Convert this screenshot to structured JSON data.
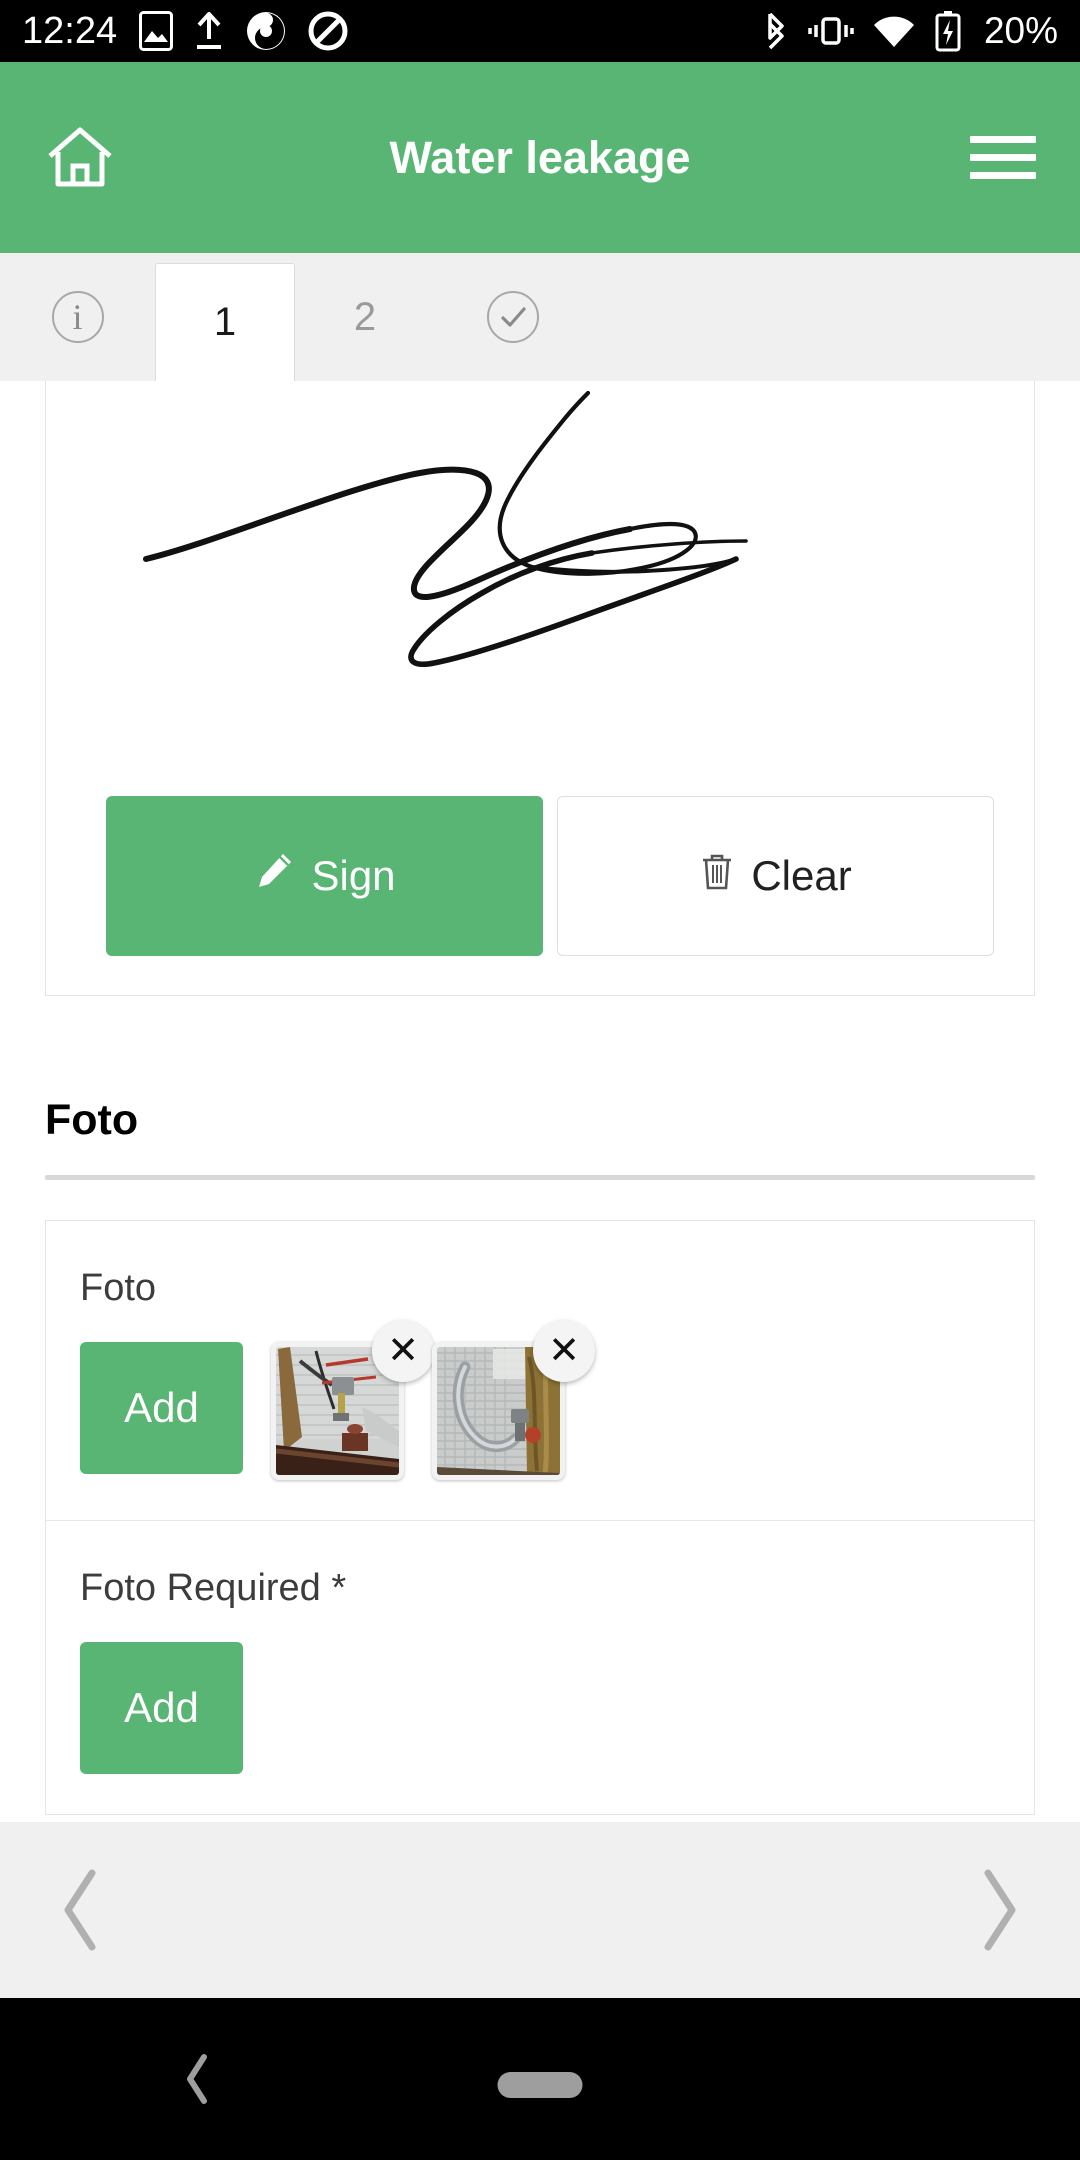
{
  "statusbar": {
    "time": "12:24",
    "left_icons": [
      "image-icon",
      "upload-icon",
      "app-icon-teal",
      "app-icon-no-symbol"
    ],
    "right_icons": [
      "bluetooth-icon",
      "vibrate-icon",
      "wifi-icon",
      "battery-charging-icon"
    ],
    "battery_text": "20%"
  },
  "appbar": {
    "title": "Water leakage",
    "home_icon": "home-icon",
    "menu_icon": "hamburger-menu-icon",
    "bg_color": "#58b573"
  },
  "tabs": [
    {
      "label": "i",
      "name": "tab-info",
      "type": "icon",
      "icon": "info-circle-icon",
      "active": false
    },
    {
      "label": "1",
      "name": "tab-page-1",
      "type": "number",
      "active": true
    },
    {
      "label": "2",
      "name": "tab-page-2",
      "type": "number",
      "active": false
    },
    {
      "label": "✓",
      "name": "tab-complete",
      "type": "icon",
      "icon": "check-circle-icon",
      "active": false
    }
  ],
  "signature": {
    "sign_label": "Sign",
    "sign_icon": "pencil-icon",
    "clear_label": "Clear",
    "clear_icon": "trash-icon",
    "sign_button_color": "#58b573"
  },
  "section": {
    "title": "Foto"
  },
  "photo_rows": [
    {
      "label": "Foto",
      "add_label": "Add",
      "name": "photo-row-foto",
      "thumbs": [
        {
          "name": "photo-thumb-1",
          "remove_label": "✕",
          "alt": "plumbing valve on tiled wall"
        },
        {
          "name": "photo-thumb-2",
          "remove_label": "✕",
          "alt": "flexible hose on tiled wall"
        }
      ]
    },
    {
      "label": "Foto Required *",
      "add_label": "Add",
      "name": "photo-row-foto-required",
      "thumbs": []
    }
  ],
  "pager": {
    "prev_icon": "chevron-left-icon",
    "next_icon": "chevron-right-icon"
  },
  "sysnav": {
    "back_icon": "back-chevron-icon",
    "home_pill": "home-pill-indicator"
  }
}
